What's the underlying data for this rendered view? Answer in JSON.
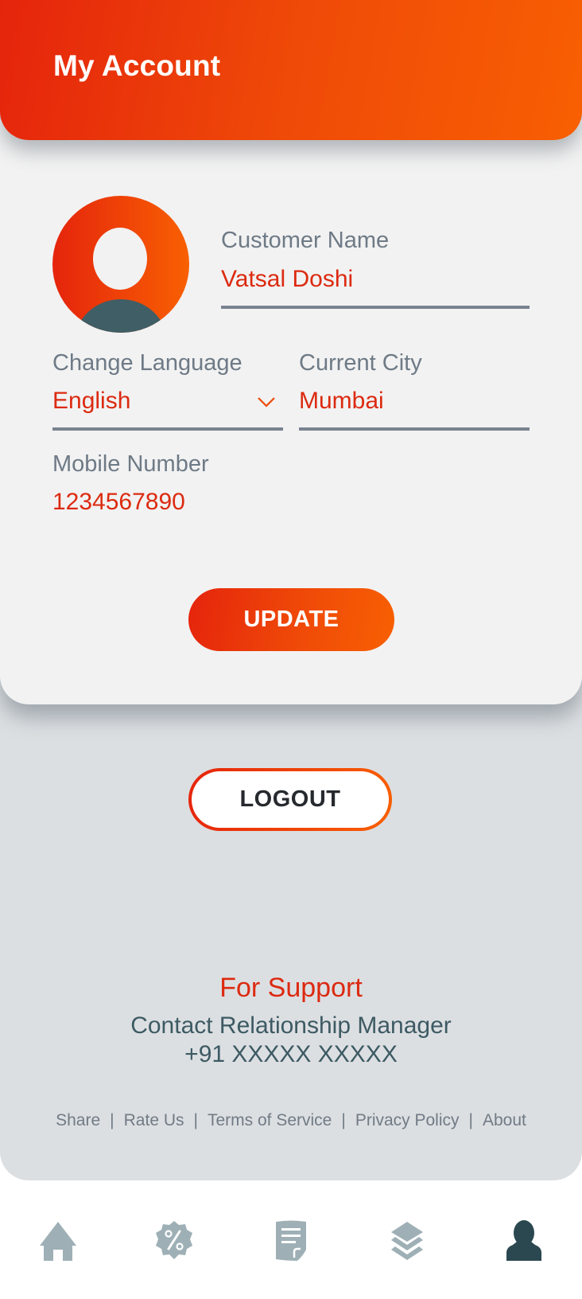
{
  "header": {
    "title": "My Account"
  },
  "profile": {
    "customer_name_label": "Customer Name",
    "customer_name_value": "Vatsal Doshi",
    "language_label": "Change Language",
    "language_value": "English",
    "city_label": "Current City",
    "city_value": "Mumbai",
    "mobile_label": "Mobile Number",
    "mobile_value": "1234567890"
  },
  "actions": {
    "update_label": "UPDATE",
    "logout_label": "LOGOUT"
  },
  "support": {
    "title": "For Support",
    "line1": "Contact Relationship Manager",
    "line2": "+91 XXXXX XXXXX"
  },
  "footer": {
    "links": [
      "Share",
      "Rate Us",
      "Terms of Service",
      "Privacy Policy",
      "About"
    ],
    "separator": "|"
  },
  "nav": {
    "items": [
      {
        "icon": "home-icon",
        "active": false
      },
      {
        "icon": "offers-icon",
        "active": false
      },
      {
        "icon": "document-icon",
        "active": false
      },
      {
        "icon": "layers-icon",
        "active": false
      },
      {
        "icon": "profile-icon",
        "active": true
      }
    ]
  },
  "colors": {
    "accent_start": "#e5240c",
    "accent_end": "#f86002",
    "value_text": "#dc2a10",
    "label_text": "#6e7a86",
    "nav_inactive": "#9eb0b6",
    "nav_active": "#2b4850"
  }
}
